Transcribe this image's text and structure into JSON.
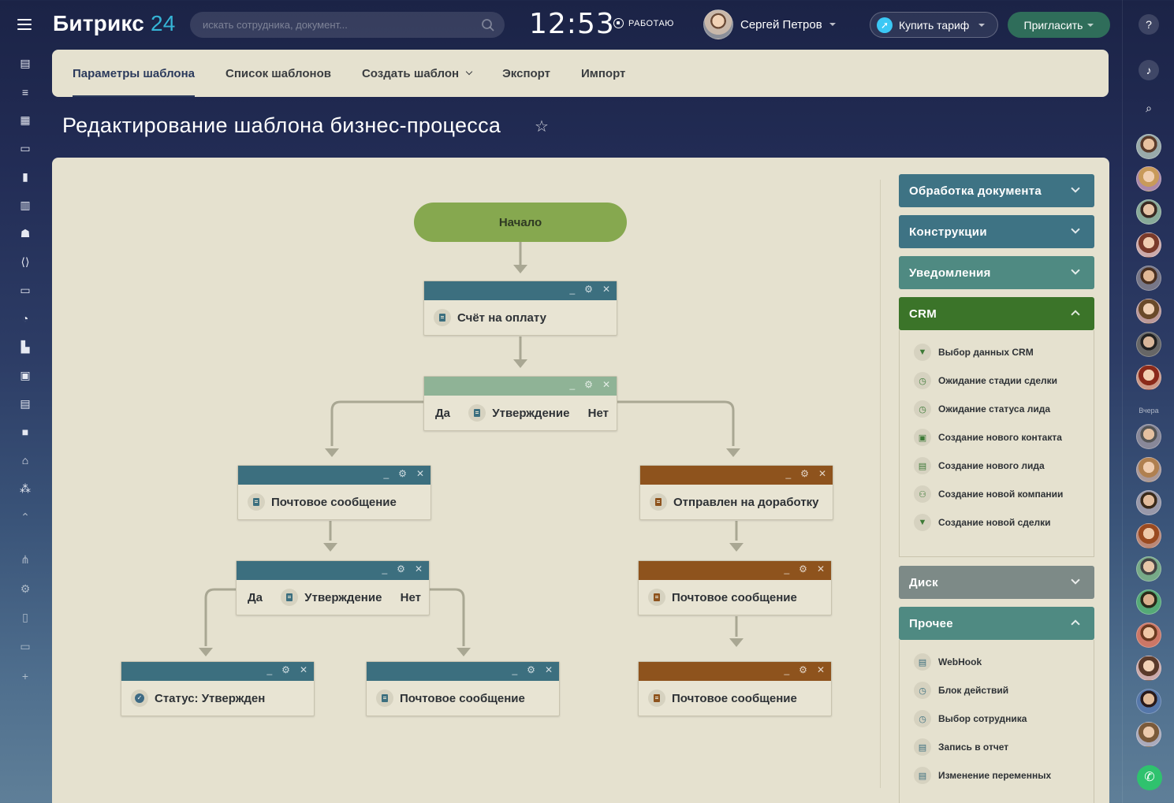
{
  "header": {
    "logo_text": "Битрикс",
    "logo_num": "24",
    "search_placeholder": "искать сотрудника, документ...",
    "clock": "12:53",
    "status": "РАБОТАЮ",
    "user_name": "Сергей Петров",
    "buy_label": "Купить тариф",
    "invite_label": "Пригласить"
  },
  "left_icons": [
    "feed-icon",
    "filter-icon",
    "dashboard-icon",
    "calendar-icon",
    "chart-icon",
    "book-icon",
    "robot-icon",
    "code-icon",
    "store-icon",
    "clock-icon",
    "company-icon",
    "image-icon",
    "document-icon",
    "video-icon",
    "bank-icon",
    "graph-icon",
    "arrow-up-icon",
    "nodes-icon",
    "gear-icon",
    "mobile-icon",
    "laptop-icon",
    "plus-icon"
  ],
  "tabs": [
    {
      "label": "Параметры шаблона"
    },
    {
      "label": "Список шаблонов"
    },
    {
      "label": "Создать шаблон"
    },
    {
      "label": "Экспорт"
    },
    {
      "label": "Импорт"
    }
  ],
  "page_title": "Редактирование шаблона бизнес-процесса",
  "flow": {
    "start": "Начало",
    "invoice": "Счёт на оплату",
    "yes": "Да",
    "no": "Нет",
    "approval": "Утверждение",
    "mail": "Почтовое сообщение",
    "rework": "Отправлен на доработку",
    "status_approved": "Статус: Утвержден"
  },
  "palette": {
    "groups": {
      "doc": "Обработка документа",
      "constructs": "Конструкции",
      "notify": "Уведомления",
      "crm": "CRM",
      "disk": "Диск",
      "other": "Прочее"
    },
    "crm_items": [
      {
        "label": "Выбор данных CRM",
        "icon": "funnel-icon"
      },
      {
        "label": "Ожидание стадии сделки",
        "icon": "clock-icon"
      },
      {
        "label": "Ожидание статуса лида",
        "icon": "clock-icon"
      },
      {
        "label": "Создание нового контакта",
        "icon": "contact-icon"
      },
      {
        "label": "Создание нового лида",
        "icon": "lead-icon"
      },
      {
        "label": "Создание новой компании",
        "icon": "company-icon"
      },
      {
        "label": "Создание новой сделки",
        "icon": "funnel-icon"
      }
    ],
    "other_items": [
      {
        "label": "WebHook",
        "icon": "document-icon"
      },
      {
        "label": "Блок действий",
        "icon": "clock-icon"
      },
      {
        "label": "Выбор сотрудника",
        "icon": "clock-icon"
      },
      {
        "label": "Запись в отчет",
        "icon": "document-icon"
      },
      {
        "label": "Изменение переменных",
        "icon": "document-icon"
      }
    ]
  },
  "right_bar": {
    "yesterday": "Вчера"
  },
  "colors": {
    "teal_header": "#3c6f7f",
    "sage_header": "#8fb396",
    "brown_header": "#8e531d",
    "start_green": "#86a84f",
    "crm_green": "#3b7429",
    "disk_gray": "#7d8a87"
  }
}
